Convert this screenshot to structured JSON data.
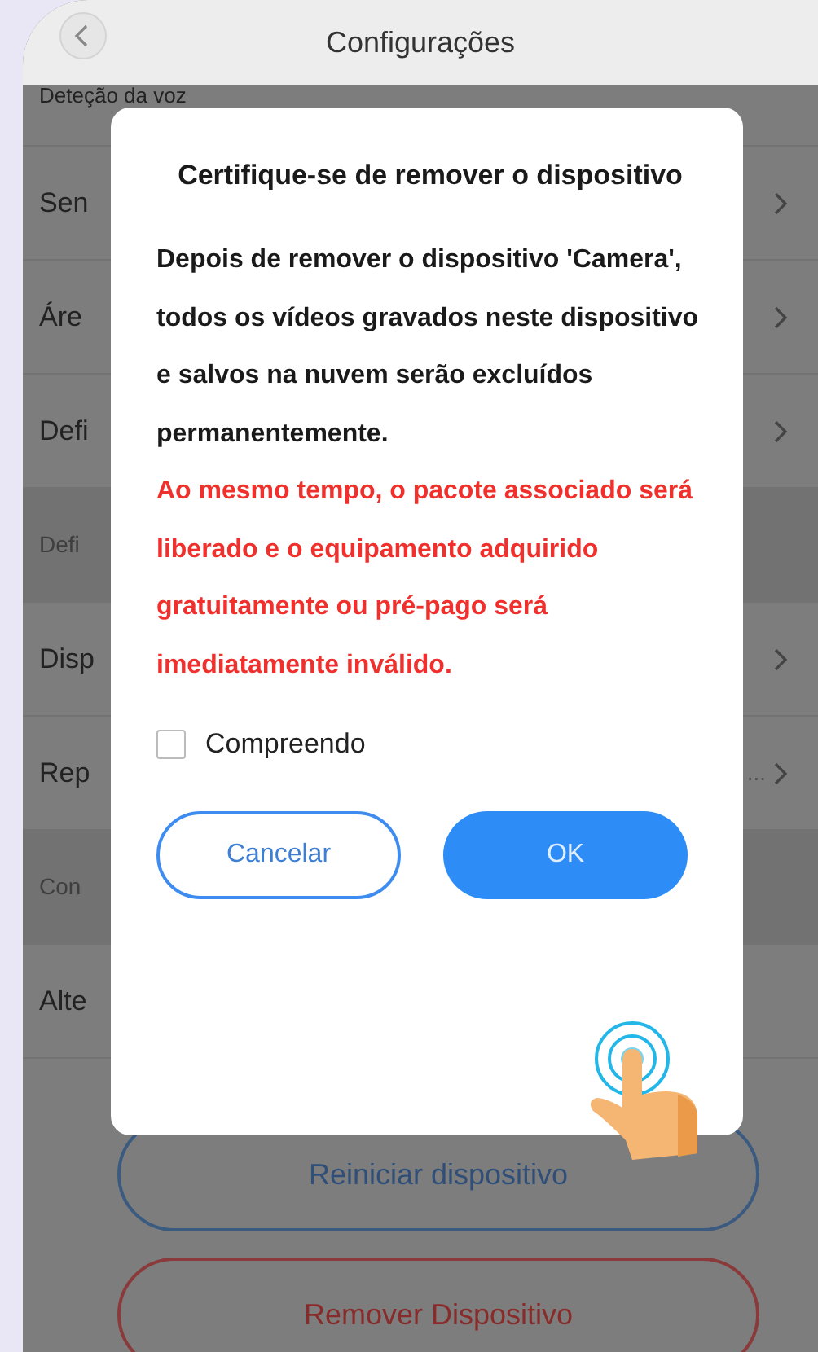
{
  "header": {
    "title": "Configurações"
  },
  "settings_rows": [
    {
      "kind": "plain",
      "label": "Deteção da voz"
    },
    {
      "kind": "item",
      "label": "Sen"
    },
    {
      "kind": "item",
      "label": "Áre"
    },
    {
      "kind": "item",
      "label": "Defi"
    },
    {
      "kind": "section",
      "label": "Defi"
    },
    {
      "kind": "item",
      "label": "Disp"
    },
    {
      "kind": "item",
      "label": "Rep",
      "value": "..."
    },
    {
      "kind": "section",
      "label": "Con"
    },
    {
      "kind": "plain",
      "label": "Alte"
    }
  ],
  "actions": [
    {
      "kind": "primary",
      "label": "Reiniciar dispositivo"
    },
    {
      "kind": "danger",
      "label": "Remover Dispositivo"
    }
  ],
  "dialog": {
    "title": "Certifique-se de remover o dispositivo",
    "message": "Depois de remover o dispositivo 'Camera', todos os vídeos gravados neste dispositivo e salvos na nuvem serão excluídos permanentemente.",
    "warning": "Ao mesmo tempo, o pacote associado será liberado e o equipamento adquirido gratuitamente ou pré-pago será imediatamente inválido.",
    "checkbox": {
      "label": "Compreendo",
      "checked": false
    },
    "buttons": [
      {
        "kind": "secondary",
        "label": "Cancelar"
      },
      {
        "kind": "primary",
        "label": "OK"
      }
    ]
  }
}
